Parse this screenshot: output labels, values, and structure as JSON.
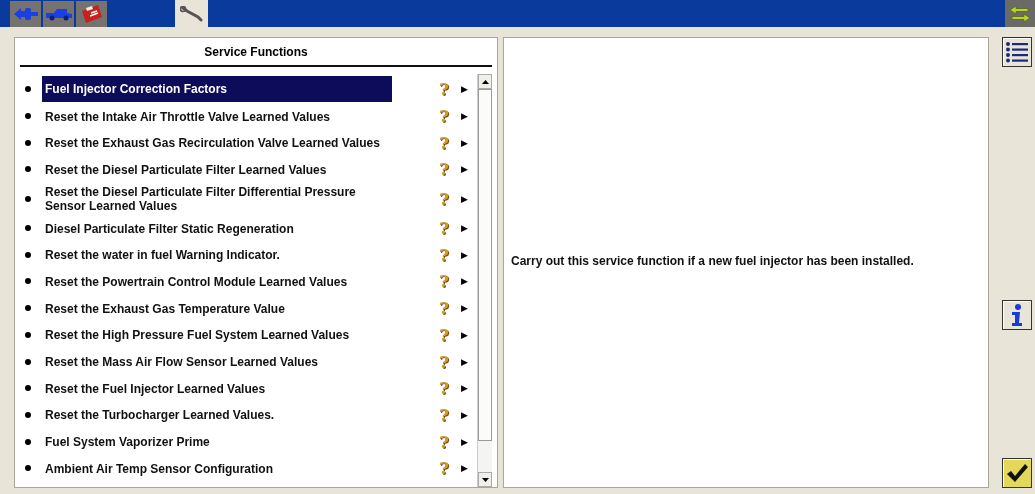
{
  "tabs": [
    {
      "kind": "connector",
      "selected": false
    },
    {
      "kind": "vehicle",
      "selected": false
    },
    {
      "kind": "toolbox",
      "selected": false
    },
    {
      "kind": "wrench",
      "selected": true
    }
  ],
  "panel_title": "Service Functions",
  "functions": [
    {
      "label": "Fuel Injector Correction Factors",
      "selected": true,
      "help": "?",
      "arrow": "▶"
    },
    {
      "label": "Reset the Intake Air Throttle Valve Learned Values",
      "selected": false,
      "help": "?",
      "arrow": "▶"
    },
    {
      "label": "Reset the Exhaust Gas Recirculation Valve Learned Values",
      "selected": false,
      "help": "?",
      "arrow": "▶"
    },
    {
      "label": "Reset the Diesel Particulate Filter Learned Values",
      "selected": false,
      "help": "?",
      "arrow": "▶"
    },
    {
      "label": "Reset the Diesel Particulate Filter Differential Pressure Sensor Learned Values",
      "selected": false,
      "help": "?",
      "arrow": "▶"
    },
    {
      "label": "Diesel Particulate Filter Static Regeneration",
      "selected": false,
      "help": "?",
      "arrow": "▶"
    },
    {
      "label": "Reset the water in fuel Warning Indicator.",
      "selected": false,
      "help": "?",
      "arrow": "▶"
    },
    {
      "label": "Reset the Powertrain Control Module Learned Values",
      "selected": false,
      "help": "?",
      "arrow": "▶"
    },
    {
      "label": "Reset the Exhaust Gas Temperature Value",
      "selected": false,
      "help": "?",
      "arrow": "▶"
    },
    {
      "label": "Reset the High Pressure Fuel System Learned Values",
      "selected": false,
      "help": "?",
      "arrow": "▶"
    },
    {
      "label": "Reset the Mass Air Flow Sensor Learned Values",
      "selected": false,
      "help": "?",
      "arrow": "▶"
    },
    {
      "label": "Reset the Fuel Injector Learned Values",
      "selected": false,
      "help": "?",
      "arrow": "▶"
    },
    {
      "label": "Reset the Turbocharger Learned Values.",
      "selected": false,
      "help": "?",
      "arrow": "▶"
    },
    {
      "label": "Fuel System Vaporizer Prime",
      "selected": false,
      "help": "?",
      "arrow": "▶"
    },
    {
      "label": "Ambient Air Temp Sensor Configuration",
      "selected": false,
      "help": "?",
      "arrow": "▶"
    }
  ],
  "description": "Carry out this service function if a new fuel injector has been installed."
}
